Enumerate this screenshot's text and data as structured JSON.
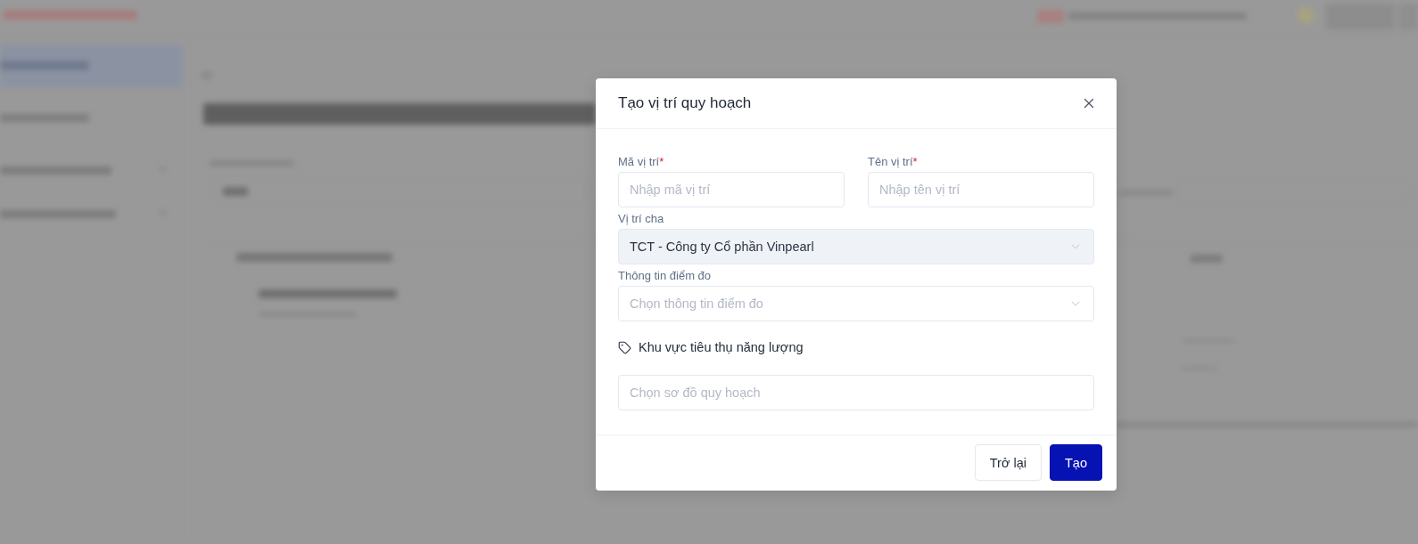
{
  "dialog": {
    "title": "Tạo vị trí quy hoạch",
    "required_mark": "*",
    "rows": [
      [
        {
          "kind": "text",
          "label": "Mã vị trí",
          "required": true,
          "disabled": false,
          "placeholder": "Nhập mã vị trí"
        },
        {
          "kind": "text",
          "label": "Tên vị trí",
          "required": true,
          "disabled": false,
          "placeholder": "Nhập tên vị trí"
        }
      ],
      [
        {
          "kind": "select",
          "label": "Vị trí cha",
          "required": false,
          "disabled": true,
          "value": "TCT - Công ty Cổ phần Vinpearl"
        }
      ],
      [
        {
          "kind": "select",
          "label": "Thông tin điểm đo",
          "required": false,
          "disabled": false,
          "placeholder": "Chọn thông tin điểm đo"
        }
      ]
    ],
    "section": {
      "title": "Khu vực tiêu thụ năng lượng",
      "field": {
        "kind": "text",
        "placeholder": "Chọn sơ đồ quy hoạch"
      }
    },
    "buttons": [
      {
        "kind": "secondary",
        "label": "Trở lại"
      },
      {
        "kind": "primary",
        "label": "Tạo"
      }
    ]
  }
}
